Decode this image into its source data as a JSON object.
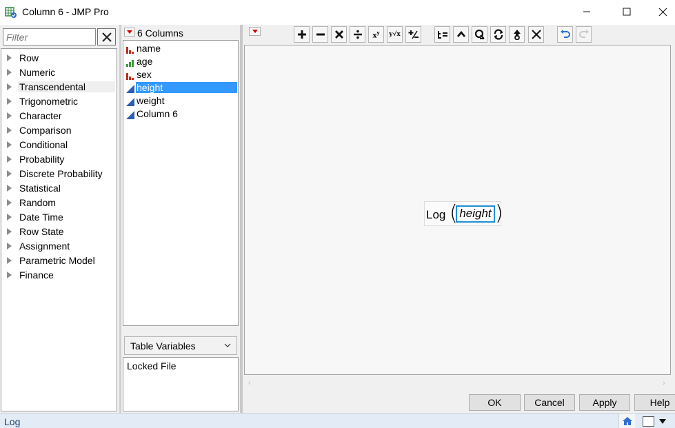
{
  "window": {
    "title": "Column 6 - JMP Pro",
    "icon": "jmp-app-icon"
  },
  "functions": {
    "filter_placeholder": "Filter",
    "selected": "Transcendental",
    "items": [
      "Row",
      "Numeric",
      "Transcendental",
      "Trigonometric",
      "Character",
      "Comparison",
      "Conditional",
      "Probability",
      "Discrete Probability",
      "Statistical",
      "Random",
      "Date Time",
      "Row State",
      "Assignment",
      "Parametric Model",
      "Finance"
    ]
  },
  "columns": {
    "count_label": "6 Columns",
    "items": [
      {
        "label": "name",
        "type": "nominal"
      },
      {
        "label": "age",
        "type": "ordinal"
      },
      {
        "label": "sex",
        "type": "nominal"
      },
      {
        "label": "height",
        "type": "continuous"
      },
      {
        "label": "weight",
        "type": "continuous"
      },
      {
        "label": "Column 6",
        "type": "continuous"
      }
    ],
    "selected": "height"
  },
  "table_variables": {
    "dropdown_label": "Table Variables",
    "items": [
      "Locked File"
    ]
  },
  "toolbar": {
    "icons": [
      "plus-icon",
      "minus-icon",
      "multiply-icon",
      "divide-icon",
      "power-icon",
      "root-icon",
      "negate-icon",
      "assign-icon",
      "peel-icon",
      "unthread-icon",
      "swap-icon",
      "raise-icon",
      "delete-icon",
      "undo-icon",
      "redo-icon"
    ],
    "power_label": "x",
    "power_sup": "y",
    "root_label": "y√x"
  },
  "formula": {
    "function": "Log",
    "argument": "height"
  },
  "buttons": {
    "ok": "OK",
    "cancel": "Cancel",
    "apply": "Apply",
    "help": "Help"
  },
  "status": {
    "text": "Log"
  },
  "colors": {
    "selection": "#3399ff",
    "nominal": "#c42b1c",
    "ordinal": "#3a9a3a",
    "continuous": "#2b5fb0",
    "undo_blue": "#2f6fd0",
    "arg_border": "#1f8fd6"
  }
}
